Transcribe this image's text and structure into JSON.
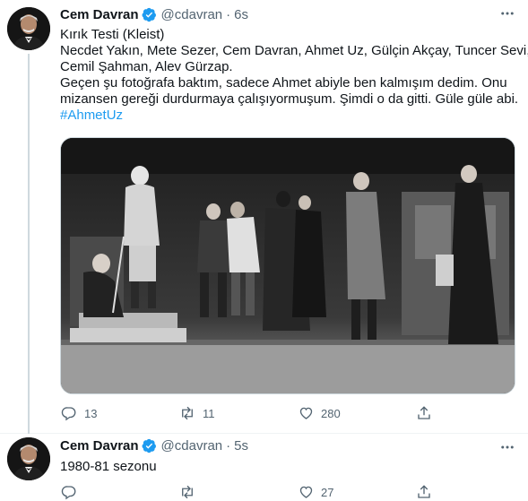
{
  "tweets": [
    {
      "author_name": "Cem Davran",
      "handle": "@cdavran",
      "separator": "·",
      "time": "6s",
      "text_lines": [
        "Kırık Testi (Kleist)",
        "Necdet Yakın, Mete Sezer, Cem Davran, Ahmet Uz, Gülçin Akçay, Tuncer Sevi,",
        "Cemil Şahman, Alev Gürzap.",
        "Geçen şu fotoğrafa baktım, sadece Ahmet abiyle ben kalmışım dedim. Onu",
        "mizansen gereği durdurmaya çalışıyormuşum. Şimdi o da gitti. Güle güle abi."
      ],
      "hashtag": "#AhmetUz",
      "actions": {
        "reply_count": "13",
        "retweet_count": "11",
        "like_count": "280"
      }
    },
    {
      "author_name": "Cem Davran",
      "handle": "@cdavran",
      "separator": "·",
      "time": "5s",
      "text_lines": [
        "1980-81 sezonu"
      ],
      "actions": {
        "reply_count": "",
        "retweet_count": "",
        "like_count": "27"
      }
    }
  ],
  "colors": {
    "accent": "#1d9bf0",
    "text": "#0f1419",
    "muted": "#536471",
    "divider": "#eff3f4"
  },
  "icons": [
    "more-icon",
    "verified-badge-icon",
    "reply-icon",
    "retweet-icon",
    "like-icon",
    "share-icon"
  ]
}
